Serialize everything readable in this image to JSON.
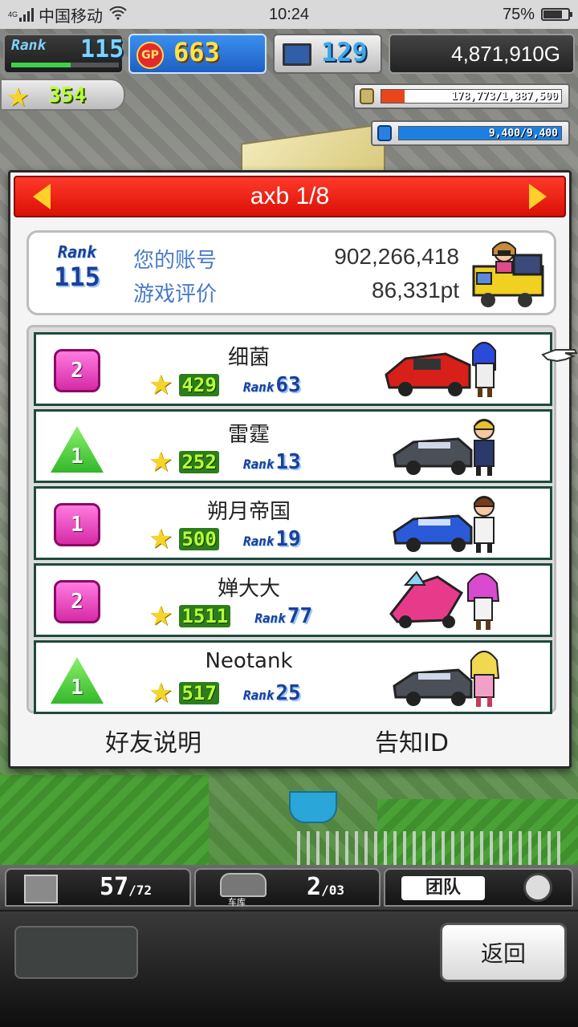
{
  "status_bar": {
    "network": "4G",
    "carrier": "中国移动",
    "time": "10:24",
    "battery": "75%",
    "battery_level": 0.75
  },
  "hud": {
    "rank_label": "Rank",
    "rank_value": "115",
    "gp_label": "GP",
    "gp_value": "663",
    "research_value": "129",
    "money": "4,871,910G",
    "stars": "354",
    "resource_bars": [
      {
        "text": "178,773/1,387,500",
        "fill": 0.13,
        "color": "#e8461a",
        "icon": "coin-stack-icon"
      },
      {
        "text": "9,400/9,400",
        "fill": 1.0,
        "color": "#1f7fe0",
        "icon": "fuel-bottle-icon"
      }
    ]
  },
  "dialog": {
    "title": "axb 1/8",
    "account": {
      "rank_label": "Rank",
      "rank_value": "115",
      "id_label": "您的账号",
      "id_value": "902,266,418",
      "rating_label": "游戏评价",
      "rating_value": "86,331pt"
    },
    "friends": [
      {
        "level": "2",
        "level_shape": "square",
        "name": "细菌",
        "stars": "429",
        "rank_label": "Rank",
        "rank": "63",
        "car_color": "#d8201a"
      },
      {
        "level": "1",
        "level_shape": "triangle",
        "name": "雷霆",
        "stars": "252",
        "rank_label": "Rank",
        "rank": "13",
        "car_color": "#4a4f58"
      },
      {
        "level": "1",
        "level_shape": "square",
        "name": "朔月帝国",
        "stars": "500",
        "rank_label": "Rank",
        "rank": "19",
        "car_color": "#2a5ad8"
      },
      {
        "level": "2",
        "level_shape": "square",
        "name": "婵大大",
        "stars": "1511",
        "rank_label": "Rank",
        "rank": "77",
        "car_color": "#e83a8a"
      },
      {
        "level": "1",
        "level_shape": "triangle",
        "name": "Neotank",
        "stars": "517",
        "rank_label": "Rank",
        "rank": "25",
        "car_color": "#4a4f58"
      }
    ],
    "friend_help": "好友说明",
    "share_id": "告知ID"
  },
  "bottom": {
    "tab1_count": "57",
    "tab1_max": "/72",
    "garage_label": "车库",
    "tab2_count": "2",
    "tab2_max": "/03",
    "team_label": "团队",
    "back_label": "返回"
  },
  "colors": {
    "header_red": "#e5140a",
    "row_border": "#1f4a3e",
    "gp_blue": "#2a77e0",
    "star_yellow": "#f6d52a"
  }
}
